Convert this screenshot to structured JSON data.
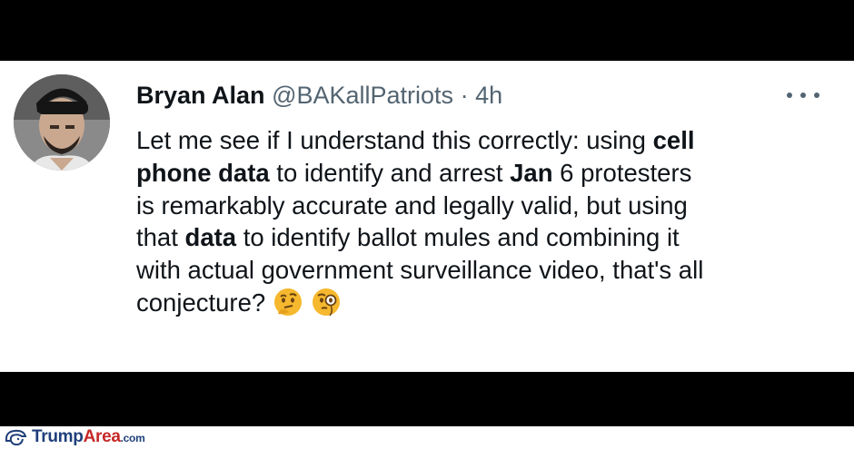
{
  "tweet": {
    "author_name": "Bryan Alan",
    "handle": "@BAKallPatriots",
    "separator": "·",
    "time": "4h",
    "avatar_icon": "profile-photo",
    "more_icon": "more-options-icon",
    "lines": [
      {
        "segments": [
          {
            "text": "Let me see if I understand this correctly: using ",
            "bold": false
          },
          {
            "text": "cell",
            "bold": true
          }
        ]
      },
      {
        "segments": [
          {
            "text": "phone data",
            "bold": true
          },
          {
            "text": " to identify and arrest ",
            "bold": false
          },
          {
            "text": "Jan",
            "bold": true
          },
          {
            "text": " 6 protesters",
            "bold": false
          }
        ]
      },
      {
        "segments": [
          {
            "text": "is remarkably accurate and legally valid, but using",
            "bold": false
          }
        ]
      },
      {
        "segments": [
          {
            "text": "that ",
            "bold": false
          },
          {
            "text": "data",
            "bold": true
          },
          {
            "text": " to identify ballot mules and combining it",
            "bold": false
          }
        ]
      },
      {
        "segments": [
          {
            "text": "with actual government surveillance video, that's all",
            "bold": false
          }
        ]
      },
      {
        "segments": [
          {
            "text": "conjecture?",
            "bold": false
          }
        ]
      }
    ],
    "emojis": [
      "thinking-face-emoji",
      "face-with-monocle-emoji"
    ]
  },
  "watermark": {
    "brand_part1": "Trump",
    "brand_part2": "Area",
    "tld": ".com",
    "logo_icon": "trump-silhouette-logo"
  },
  "colors": {
    "name": "#0f1419",
    "meta": "#536471",
    "background_frame": "#000000",
    "watermark_blue": "#1f3f7a",
    "watermark_red": "#c62828"
  }
}
